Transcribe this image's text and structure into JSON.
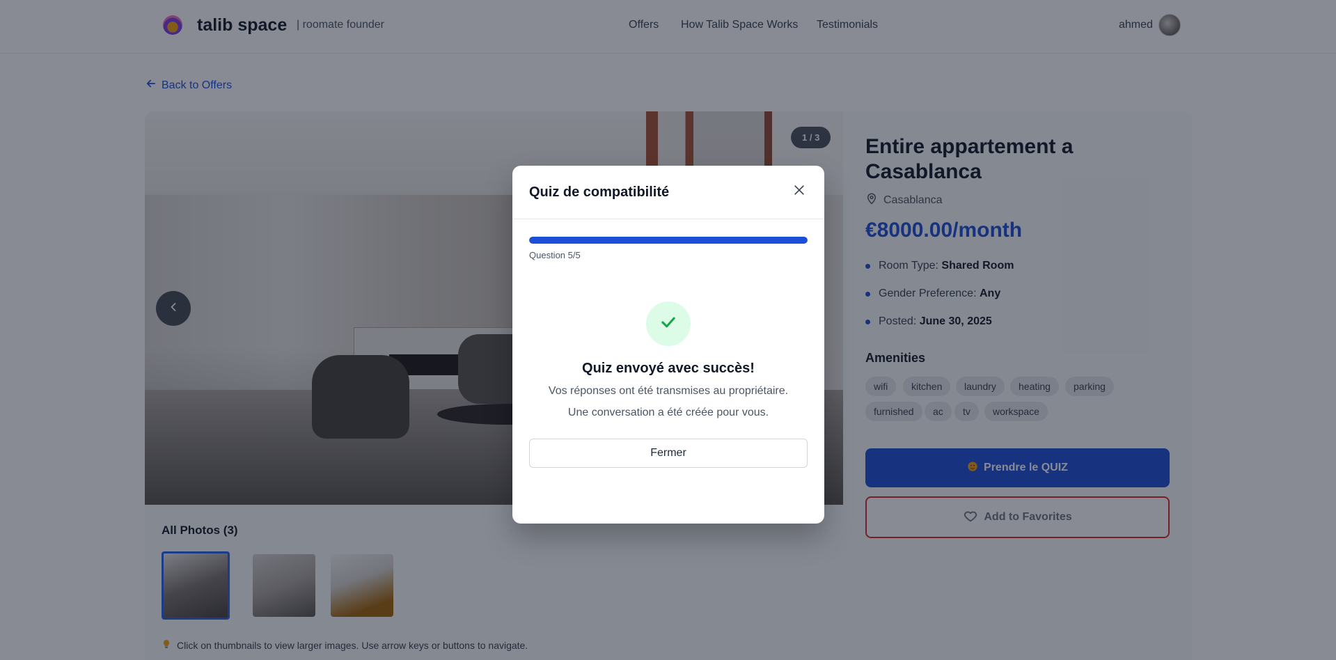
{
  "header": {
    "brand": "talib space",
    "tagline": "| roomate founder",
    "nav": [
      "Offers",
      "How Talib Space Works",
      "Testimonials"
    ],
    "user_name": "ahmed"
  },
  "back_link": "Back to Offers",
  "gallery": {
    "counter": "1 / 3",
    "photos_title": "All Photos (3)",
    "hint": "Click on thumbnails to view larger images. Use arrow keys or buttons to navigate."
  },
  "listing": {
    "title": "Entire appartement a Casablanca",
    "location": "Casablanca",
    "price": "€8000.00/month",
    "details": [
      {
        "label": "Room Type:",
        "value": "Shared Room"
      },
      {
        "label": "Gender Preference:",
        "value": "Any"
      },
      {
        "label": "Posted:",
        "value": "June 30, 2025"
      }
    ],
    "amenities_title": "Amenities",
    "amenities": [
      "wifi",
      "kitchen",
      "laundry",
      "heating",
      "parking",
      "furnished",
      "ac",
      "tv",
      "workspace"
    ],
    "quiz_button": "Prendre le QUIZ",
    "favorites_button": "Add to Favorites"
  },
  "modal": {
    "title": "Quiz de compatibilité",
    "progress_fraction": 1.0,
    "question_label": "Question 5/5",
    "success_title": "Quiz envoyé avec succès!",
    "success_line1": "Vos réponses ont été transmises au propriétaire.",
    "success_line2": "Une conversation a été créée pour vous.",
    "close_button": "Fermer"
  },
  "colors": {
    "accent": "#1d4ed8",
    "danger": "#dc2626",
    "success_bg": "#dcfce7",
    "success_check": "#16a34a"
  }
}
